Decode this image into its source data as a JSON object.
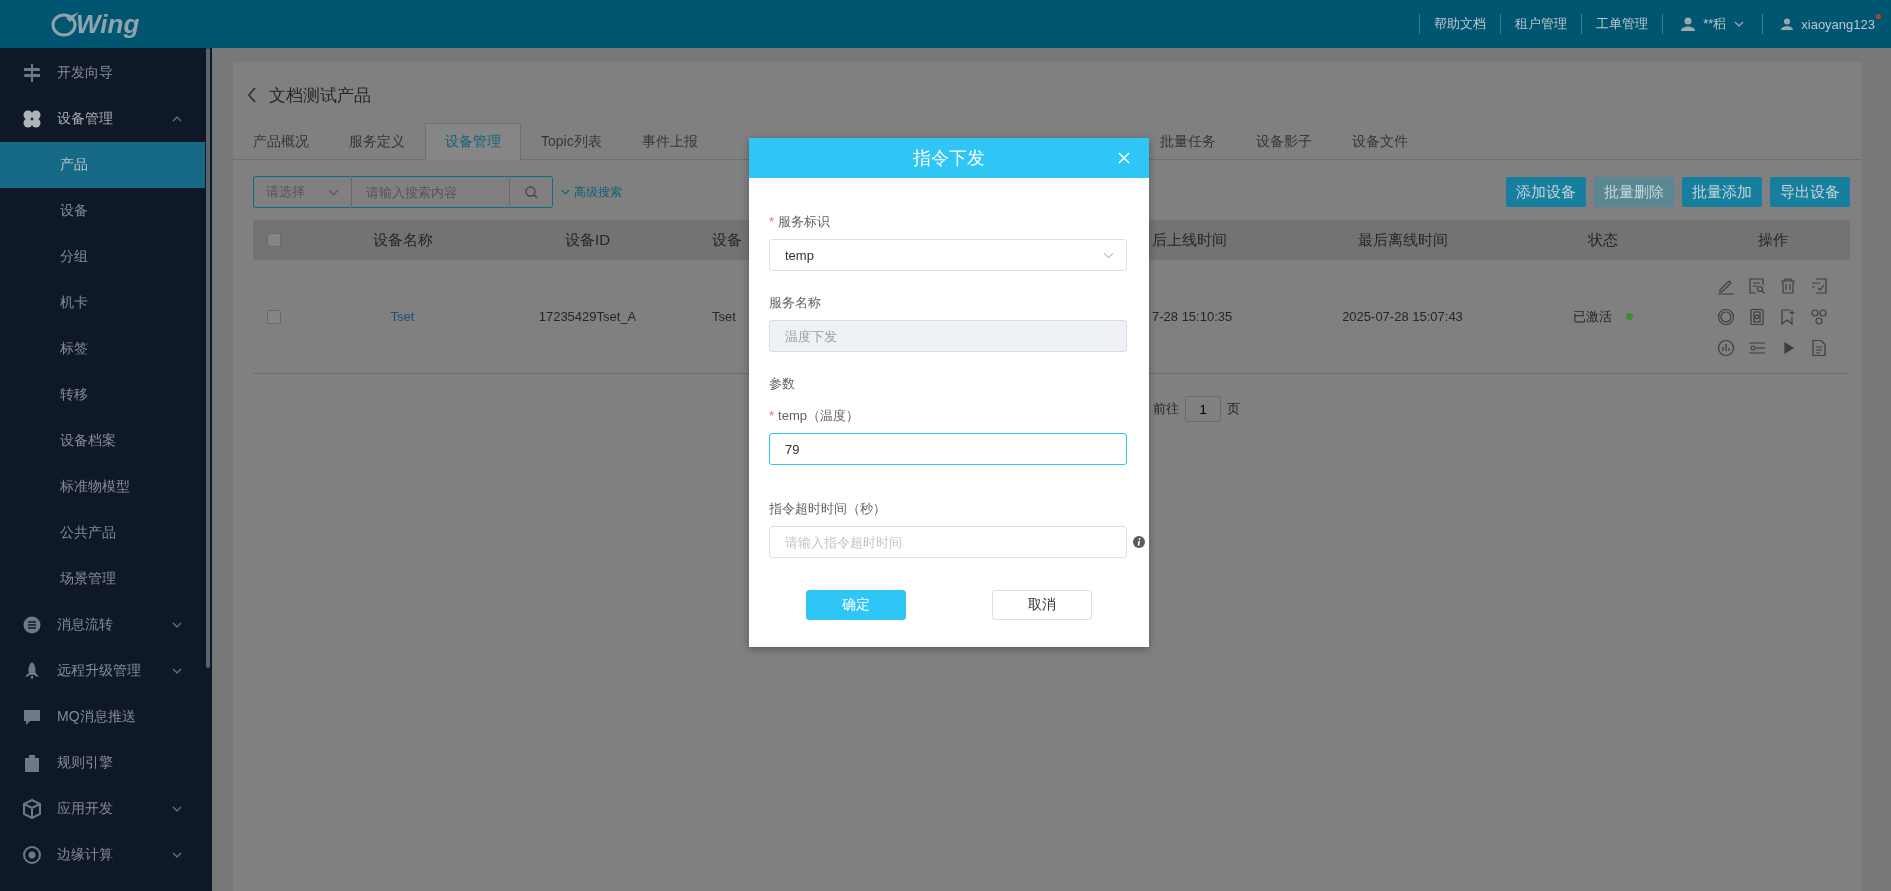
{
  "header": {
    "logo_text": "Wing",
    "links": [
      "帮助文档",
      "租户管理",
      "工单管理"
    ],
    "tenant": "**稆",
    "user": {
      "name": "xiaoyang123",
      "notification": true
    }
  },
  "sidebar": {
    "items": [
      {
        "label": "开发向导"
      },
      {
        "label": "设备管理",
        "expanded": true,
        "children": [
          {
            "label": "产品",
            "selected": true
          },
          {
            "label": "设备",
            "selected": false
          },
          {
            "label": "分组",
            "selected": false
          },
          {
            "label": "机卡",
            "selected": false
          },
          {
            "label": "标签",
            "selected": false
          },
          {
            "label": "转移",
            "selected": false
          },
          {
            "label": "设备档案",
            "selected": false
          },
          {
            "label": "标准物模型",
            "selected": false
          },
          {
            "label": "公共产品",
            "selected": false
          },
          {
            "label": "场景管理",
            "selected": false
          }
        ]
      },
      {
        "label": "消息流转",
        "expanded": false
      },
      {
        "label": "远程升级管理",
        "expanded": false
      },
      {
        "label": "MQ消息推送"
      },
      {
        "label": "规则引擎"
      },
      {
        "label": "应用开发",
        "expanded": false
      },
      {
        "label": "边缘计算",
        "expanded": false
      }
    ]
  },
  "page": {
    "title": "文档测试产品",
    "tabs": [
      {
        "label": "产品概况",
        "selected": false
      },
      {
        "label": "服务定义",
        "selected": false
      },
      {
        "label": "设备管理",
        "selected": true
      },
      {
        "label": "Topic列表",
        "selected": false
      },
      {
        "label": "事件上报",
        "selected": false
      },
      {
        "label": "批量任务",
        "selected": false
      },
      {
        "label": "设备影子",
        "selected": false
      },
      {
        "label": "设备文件",
        "selected": false
      }
    ],
    "search": {
      "select_placeholder": "请选择",
      "placeholder": "请输入搜索内容"
    },
    "advanced_search": "高级搜索",
    "buttons": [
      {
        "label": "添加设备",
        "disabled": false
      },
      {
        "label": "批量删除",
        "disabled": true
      },
      {
        "label": "批量添加",
        "disabled": false
      },
      {
        "label": "导出设备",
        "disabled": false
      }
    ],
    "table": {
      "all_checked": false,
      "columns": [
        "设备名称",
        "设备ID",
        "设备",
        "后上线时间",
        "最后离线时间",
        "状态",
        "操作"
      ],
      "rows": [
        {
          "checked": false,
          "name": "Tset",
          "device_id": "17235429Tset_A",
          "column_3": "Tset",
          "online_time": "7-28 15:10:35",
          "offline_time": "2025-07-28 15:07:43",
          "status": "已激活",
          "color": "#3f8a3a"
        }
      ]
    },
    "pagination": {
      "goto": "前往",
      "page": "1",
      "suffix": "页"
    }
  },
  "dialog": {
    "title": "指令下发",
    "fields": [
      {
        "kind": "select",
        "required_mark": "*",
        "label": "服务标识",
        "value": "temp"
      },
      {
        "kind": "text",
        "label": "服务名称",
        "disabled": true,
        "placeholder": "温度下发"
      },
      {
        "kind": "section",
        "label": "参数"
      },
      {
        "kind": "text",
        "required_mark": "*",
        "label": "temp（温度）",
        "value": "79",
        "focused": true
      },
      {
        "kind": "text",
        "label": "指令超时时间（秒）",
        "placeholder": "请输入指令超时时间",
        "info": true
      }
    ],
    "buttons": [
      {
        "label": "确定",
        "kind": "primary"
      },
      {
        "label": "取消",
        "kind": "default"
      }
    ]
  }
}
